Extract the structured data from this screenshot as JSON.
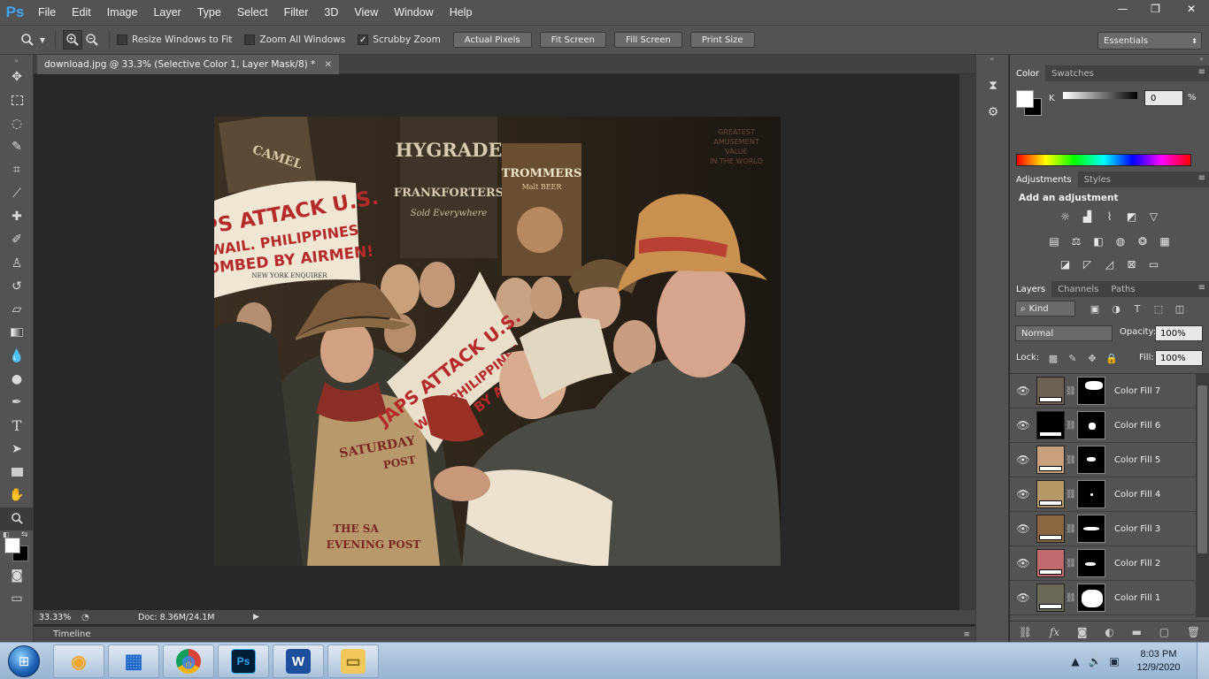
{
  "app": {
    "logo": "Ps"
  },
  "menu": [
    "File",
    "Edit",
    "Image",
    "Layer",
    "Type",
    "Select",
    "Filter",
    "3D",
    "View",
    "Window",
    "Help"
  ],
  "window_controls": {
    "minimize": "—",
    "restore": "❐",
    "close": "✕"
  },
  "options": {
    "resize_windows": "Resize Windows to Fit",
    "zoom_all": "Zoom All Windows",
    "scrubby_zoom": "Scrubby Zoom",
    "actual_pixels": "Actual Pixels",
    "fit_screen": "Fit Screen",
    "fill_screen": "Fill Screen",
    "print_size": "Print Size",
    "workspace": "Essentials"
  },
  "document": {
    "tab_title": "download.jpg @ 33.3% (Selective Color 1, Layer Mask/8) *",
    "zoom": "33.33%",
    "doc_size": "Doc: 8.36M/24.1M",
    "timeline": "Timeline",
    "photo": {
      "headline_left": [
        "JAPS ATTACK U.S.",
        "WAIL. PHILIPPINES",
        "BOMBED BY AIRMEN!"
      ],
      "headline_left_sub": "NEW YORK ENQUIRER",
      "headline_center": [
        "JAPS ATTACK U.S.",
        "WAIL. PHILIPPINES",
        "BED BY AIR"
      ],
      "apron_top": [
        "SATURDAY",
        "POST"
      ],
      "apron_bottom": [
        "THE SA",
        "EVENING POST"
      ],
      "sign_hygrade": [
        "HYGRADE",
        "FRANKFORTERS",
        "Sold Everywhere"
      ],
      "sign_trommers": [
        "TROMMERS",
        "Malt BEER"
      ],
      "sign_camel": "CAMEL",
      "sign_amusement": [
        "GREATEST",
        "AMUSEMENT",
        "VALUE",
        "IN THE WORLD"
      ]
    }
  },
  "panels": {
    "color_tab": "Color",
    "swatches_tab": "Swatches",
    "k_label": "K",
    "k_value": "0",
    "k_unit": "%",
    "adjustments_tab": "Adjustments",
    "styles_tab": "Styles",
    "add_adjustment": "Add an adjustment",
    "layers_tab": "Layers",
    "channels_tab": "Channels",
    "paths_tab": "Paths",
    "filter_kind": "Kind",
    "blend_mode": "Normal",
    "opacity_label": "Opacity:",
    "opacity": "100%",
    "lock_label": "Lock:",
    "fill_label": "Fill:",
    "fill": "100%"
  },
  "layers": [
    {
      "name": "Color Fill 7",
      "color": "#6e6050"
    },
    {
      "name": "Color Fill 6",
      "color": "#000000"
    },
    {
      "name": "Color Fill 5",
      "color": "#c8a07e"
    },
    {
      "name": "Color Fill 4",
      "color": "#b59a68"
    },
    {
      "name": "Color Fill 3",
      "color": "#8a6641"
    },
    {
      "name": "Color Fill 2",
      "color": "#c06a6e"
    },
    {
      "name": "Color Fill 1",
      "color": "#6b6a58"
    }
  ],
  "taskbar": {
    "time": "8:03 PM",
    "date": "12/9/2020",
    "apps": [
      {
        "id": "ie",
        "glyph": "◉"
      },
      {
        "id": "control",
        "glyph": "▦"
      },
      {
        "id": "chrome",
        "glyph": "◍"
      },
      {
        "id": "photoshop",
        "glyph": "Ps"
      },
      {
        "id": "word",
        "glyph": "W"
      },
      {
        "id": "explorer",
        "glyph": "▭"
      }
    ]
  }
}
